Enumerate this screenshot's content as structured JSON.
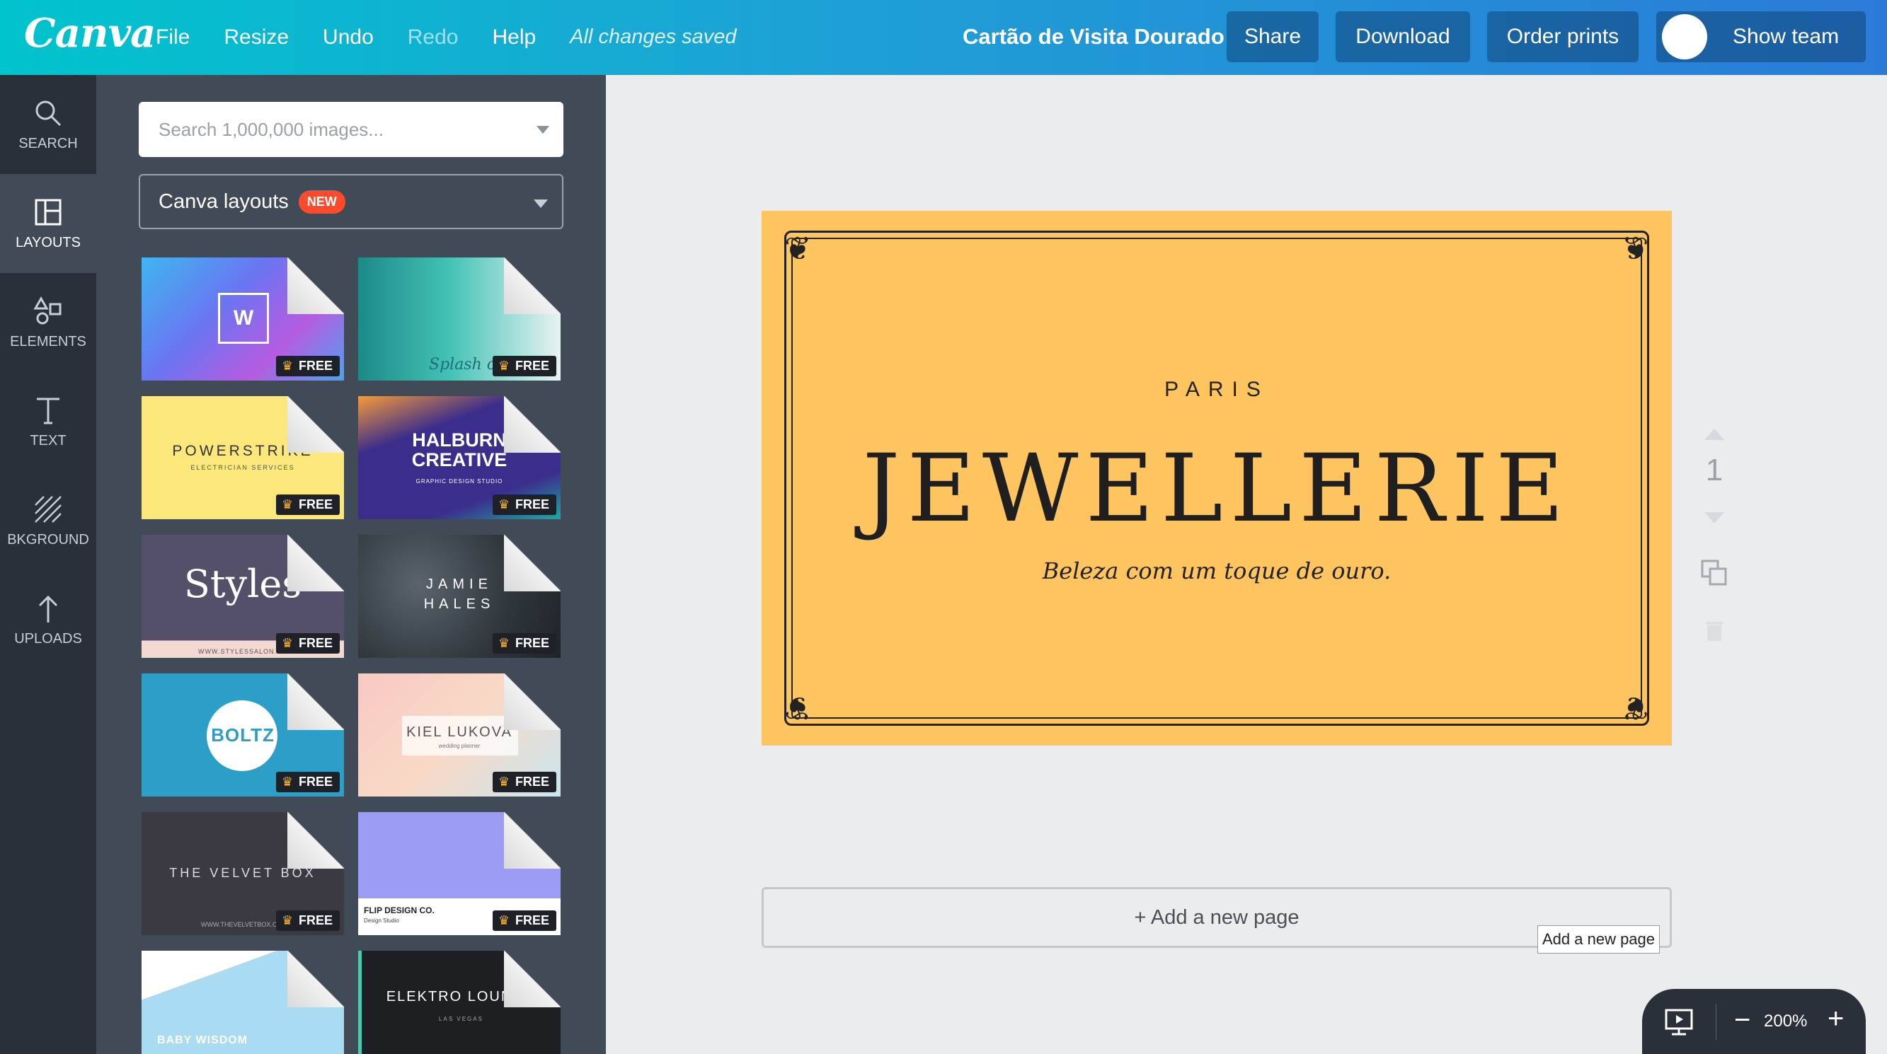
{
  "topbar": {
    "logo": "Canva",
    "menu": [
      "File",
      "Resize",
      "Undo",
      "Redo",
      "Help"
    ],
    "saved_status": "All changes saved",
    "document_title": "Cartão de Visita Dourado",
    "share": "Share",
    "download": "Download",
    "order_prints": "Order prints",
    "show_team": "Show team"
  },
  "rail": [
    {
      "label": "SEARCH",
      "icon": "search-icon"
    },
    {
      "label": "LAYOUTS",
      "icon": "layouts-icon"
    },
    {
      "label": "ELEMENTS",
      "icon": "shapes-icon"
    },
    {
      "label": "TEXT",
      "icon": "text-icon"
    },
    {
      "label": "BKGROUND",
      "icon": "background-icon"
    },
    {
      "label": "UPLOADS",
      "icon": "upload-icon"
    }
  ],
  "panel": {
    "search_placeholder": "Search 1,000,000 images...",
    "layout_select": "Canva layouts",
    "new_badge": "NEW",
    "free_label": "FREE",
    "tiles": [
      {
        "text": "W",
        "bg": "#7d5bd6"
      },
      {
        "text": "Splash of",
        "bg": "#2ab5a8"
      },
      {
        "text": "POWERSTRIKE",
        "sub": "ELECTRICIAN SERVICES",
        "bg": "#fbe77a"
      },
      {
        "text": "HALBURN CREATIVE",
        "sub": "GRAPHIC DESIGN STUDIO",
        "bg": "#3b2d8c"
      },
      {
        "text": "Styles",
        "sub": "WWW.STYLESSALON.C",
        "bg": "#55506a"
      },
      {
        "text": "JAMIE HALES",
        "bg": "#3a4148"
      },
      {
        "text": "BOLTZ",
        "bg": "#2b9fc8"
      },
      {
        "text": "KIEL LUKOVA",
        "sub": "wedding planner",
        "bg": "#f7c9c4"
      },
      {
        "text": "THE VELVET BOX",
        "sub": "WWW.THEVELVETBOX.C",
        "bg": "#3b3a42"
      },
      {
        "text": "FLIP DESIGN CO.",
        "sub": "Design Studio",
        "bg": "#9d9cf5"
      },
      {
        "text": "BABY WISDOM",
        "bg": "#a9dbf2"
      },
      {
        "text": "ELEKTRO LOUNGE",
        "sub": "LAS VEGAS",
        "bg": "#1d1f22"
      }
    ]
  },
  "card": {
    "city": "PARIS",
    "title": "JEWELLERIE",
    "tagline": "Beleza com um toque de ouro."
  },
  "page_number": "1",
  "add_page": "+ Add a new page",
  "tooltip": "Add a new page",
  "zoom": "200%"
}
